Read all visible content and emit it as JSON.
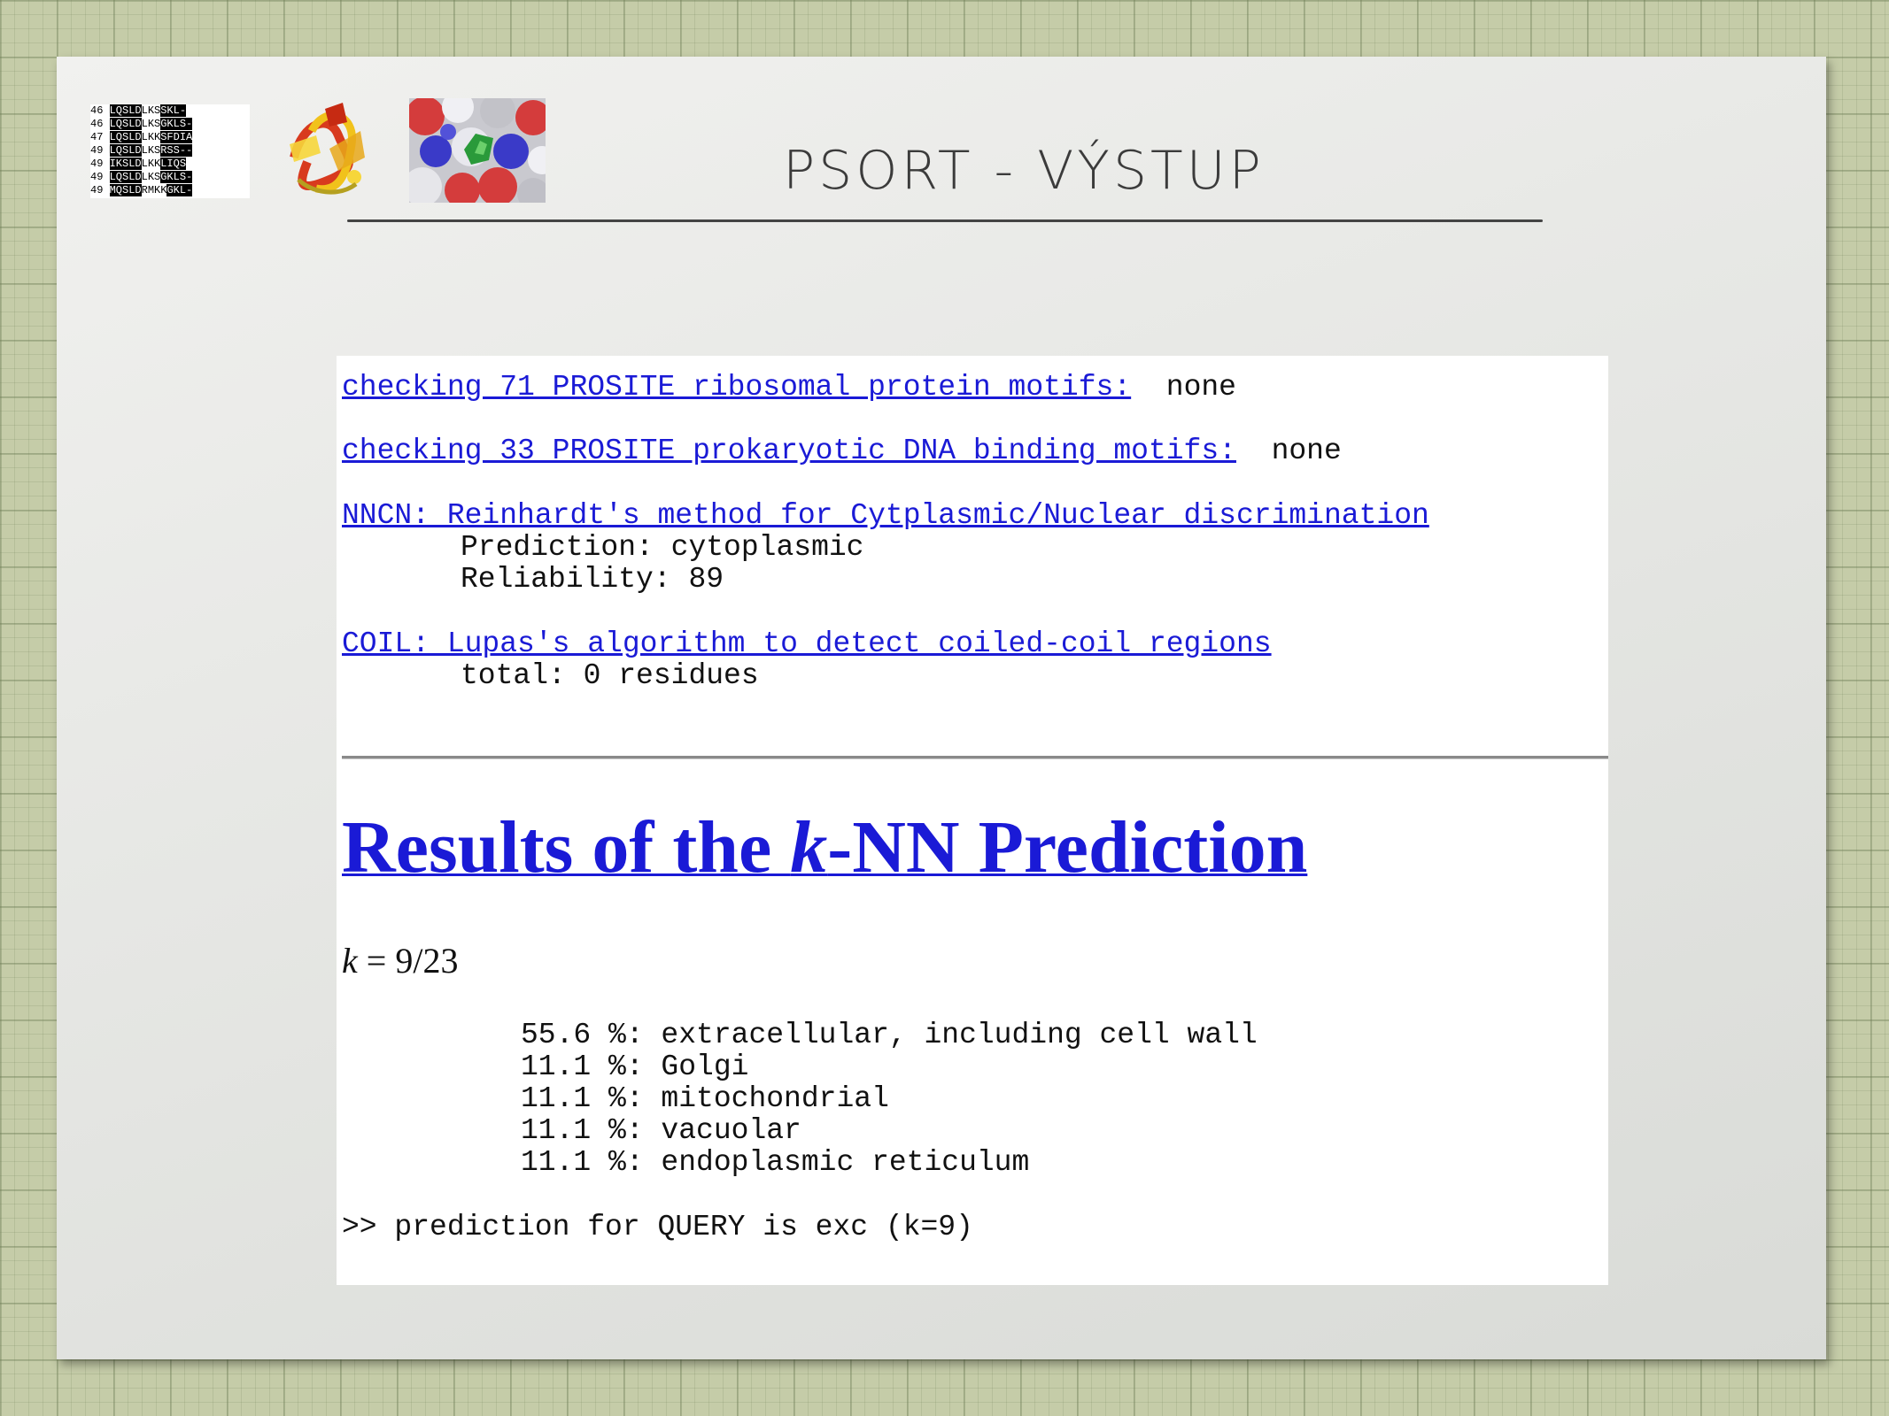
{
  "slide": {
    "title": "PSORT - VÝSTUP",
    "thumbnail_alignment": {
      "rows": [
        {
          "num": "46",
          "seq": "LQSLD",
          "tail": "LKS",
          "end": "SKL-"
        },
        {
          "num": "46",
          "seq": "LQSLD",
          "tail": "LKS",
          "end": "GKLS-"
        },
        {
          "num": "47",
          "seq": "LQSLD",
          "tail": "LKK",
          "end": "SFDIA"
        },
        {
          "num": "49",
          "seq": "LQSLD",
          "tail": "LKS",
          "end": "RSS--"
        },
        {
          "num": "49",
          "seq": "IKSLD",
          "tail": "LKK",
          "end": "LIQS"
        },
        {
          "num": "49",
          "seq": "LQSLD",
          "tail": "LKS",
          "end": "GKLS-"
        },
        {
          "num": "49",
          "seq": "MQSLD",
          "tail": "RMKK",
          "end": "GKL-"
        }
      ]
    },
    "icons": [
      "protein-cartoon-icon",
      "protein-surface-icon"
    ]
  },
  "output": {
    "ribosomal": {
      "link": "checking 71 PROSITE ribosomal protein motifs:",
      "result": "none"
    },
    "dna_binding": {
      "link": "checking 33 PROSITE prokaryotic DNA binding motifs:",
      "result": "none"
    },
    "nncn": {
      "link": "NNCN: Reinhardt's method for Cytplasmic/Nuclear discrimination",
      "prediction": "Prediction: cytoplasmic",
      "reliability": "Reliability: 89"
    },
    "coil": {
      "link": "COIL: Lupas's algorithm to detect coiled-coil regions",
      "total": "total: 0 residues"
    },
    "knn": {
      "heading_pre": "Results of the ",
      "heading_k": "k",
      "heading_post": "-NN Prediction",
      "k_italic": "k",
      "k_rest": " = 9/23",
      "results": [
        "55.6 %: extracellular, including cell wall",
        "11.1 %: Golgi",
        "11.1 %: mitochondrial",
        "11.1 %: vacuolar",
        "11.1 %: endoplasmic reticulum"
      ],
      "final": ">> prediction for QUERY is exc (k=9)"
    }
  },
  "colors": {
    "link": "#1a1ad6",
    "background_grid": "#c5cca8",
    "slide": "#e9eae7"
  }
}
